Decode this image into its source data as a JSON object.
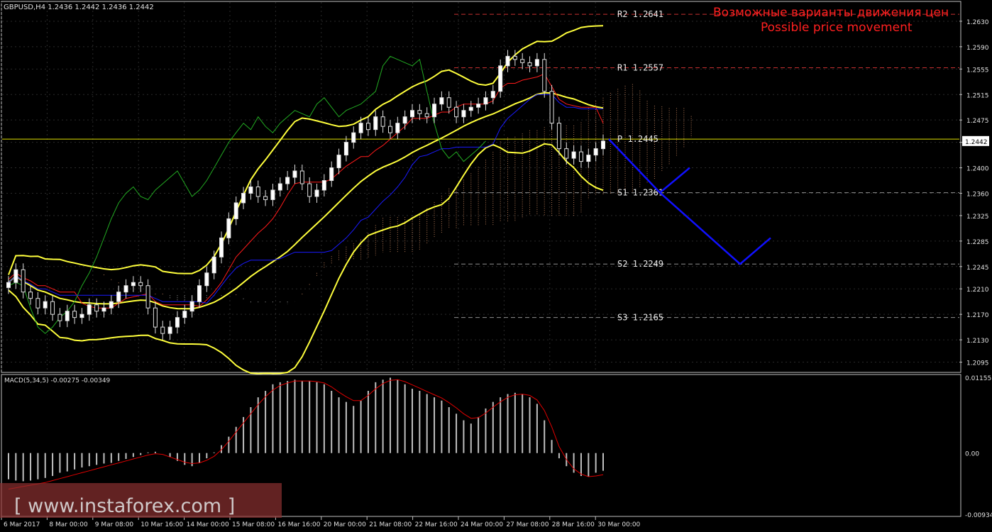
{
  "header": {
    "symbol_line": "GBPUSD,H4  1.2436 1.2442 1.2436 1.2442",
    "macd_line": "MACD(5,34,5) -0.00275 -0.00349"
  },
  "annotations": {
    "title_ru": "Возможные варианты движения цен",
    "title_en": "Possible price movement"
  },
  "watermark": "[ www.instaforex.com ]",
  "colors": {
    "background": "#000000",
    "grid": "#2a2a2a",
    "axis": "#c0c0c0",
    "bollinger": "#ffff3c",
    "tenkan": "#ff1a1a",
    "kijun": "#1a1aff",
    "chikou": "#22aa22",
    "cloud_a": "#f0a070",
    "cloud_b": "#d0d0d0",
    "forecast": "#1010ff",
    "level_red": "#c83030",
    "level_pivot": "#e0e000",
    "annotation_red": "#ff2020",
    "macd_hist": "#c0c0c0",
    "macd_signal": "#e00000"
  },
  "chart_data": {
    "type": "candlestick",
    "instrument": "GBPUSD",
    "timeframe": "H4",
    "ylim": [
      1.208,
      1.266
    ],
    "y_ticks": [
      "1.2630",
      "1.2590",
      "1.2555",
      "1.2515",
      "1.2475",
      "1.2440",
      "1.2400",
      "1.2360",
      "1.2325",
      "1.2285",
      "1.2245",
      "1.2210",
      "1.2170",
      "1.2130",
      "1.2095"
    ],
    "current_price": "1.2442",
    "current_value": 1.2442,
    "x_labels": [
      "6 Mar 2017",
      "8 Mar 00:00",
      "9 Mar 08:00",
      "10 Mar 16:00",
      "14 Mar 00:00",
      "15 Mar 08:00",
      "16 Mar 16:00",
      "20 Mar 00:00",
      "21 Mar 08:00",
      "22 Mar 16:00",
      "24 Mar 00:00",
      "27 Mar 08:00",
      "28 Mar 16:00",
      "30 Mar 00:00"
    ],
    "levels": [
      {
        "label": "R2  1.2641",
        "value": 1.2641,
        "kind": "resistance"
      },
      {
        "label": "R1  1.2557",
        "value": 1.2557,
        "kind": "resistance"
      },
      {
        "label": "P  1.2445",
        "value": 1.2445,
        "kind": "pivot"
      },
      {
        "label": "S1  1.2361",
        "value": 1.2361,
        "kind": "support"
      },
      {
        "label": "S2  1.2249",
        "value": 1.2249,
        "kind": "support"
      },
      {
        "label": "S3  1.2165",
        "value": 1.2165,
        "kind": "support"
      }
    ],
    "forecast_path": [
      1.2445,
      1.2361,
      1.24,
      1.2361,
      1.2249,
      1.229
    ],
    "close": [
      1.222,
      1.224,
      1.2205,
      1.2195,
      1.218,
      1.219,
      1.217,
      1.216,
      1.2175,
      1.2165,
      1.217,
      1.2185,
      1.2175,
      1.218,
      1.219,
      1.2205,
      1.2215,
      1.222,
      1.2215,
      1.218,
      1.215,
      1.214,
      1.215,
      1.2165,
      1.2175,
      1.219,
      1.2215,
      1.2235,
      1.226,
      1.229,
      1.232,
      1.2345,
      1.236,
      1.237,
      1.2355,
      1.235,
      1.2365,
      1.2375,
      1.2385,
      1.2395,
      1.2375,
      1.2355,
      1.2365,
      1.238,
      1.24,
      1.242,
      1.244,
      1.2455,
      1.247,
      1.246,
      1.248,
      1.2465,
      1.2455,
      1.247,
      1.248,
      1.249,
      1.2485,
      1.248,
      1.25,
      1.251,
      1.2495,
      1.248,
      1.249,
      1.2495,
      1.25,
      1.251,
      1.252,
      1.256,
      1.2575,
      1.257,
      1.2565,
      1.256,
      1.257,
      1.252,
      1.247,
      1.243,
      1.2415,
      1.2425,
      1.241,
      1.242,
      1.243,
      1.2442
    ],
    "macd": {
      "ylim": [
        -0.00934,
        0.01155
      ],
      "y_ticks": [
        "0.01155",
        "0.00",
        "-0.00934"
      ],
      "histogram": [
        -0.004,
        -0.0042,
        -0.0043,
        -0.0042,
        -0.004,
        -0.0038,
        -0.0035,
        -0.003,
        -0.0028,
        -0.0025,
        -0.0022,
        -0.002,
        -0.0018,
        -0.0016,
        -0.0015,
        -0.0012,
        -0.0009,
        -0.0006,
        -0.0003,
        0.0001,
        0.0002,
        0.0,
        -0.0006,
        -0.0012,
        -0.0018,
        -0.002,
        -0.0015,
        -0.0008,
        0.0001,
        0.0012,
        0.0025,
        0.004,
        0.0055,
        0.007,
        0.0085,
        0.0095,
        0.0105,
        0.0108,
        0.011,
        0.0112,
        0.011,
        0.011,
        0.0108,
        0.0105,
        0.0095,
        0.0085,
        0.0078,
        0.0072,
        0.008,
        0.0095,
        0.0108,
        0.0112,
        0.0115,
        0.0112,
        0.0105,
        0.0098,
        0.0095,
        0.009,
        0.0085,
        0.008,
        0.007,
        0.006,
        0.005,
        0.0045,
        0.0055,
        0.0068,
        0.0078,
        0.0085,
        0.009,
        0.0092,
        0.009,
        0.0085,
        0.0075,
        0.005,
        0.002,
        -0.0008,
        -0.002,
        -0.003,
        -0.0035,
        -0.0036,
        -0.003,
        -0.0027
      ],
      "signal": [
        -0.0055,
        -0.0053,
        -0.0051,
        -0.0049,
        -0.0047,
        -0.0045,
        -0.0042,
        -0.0039,
        -0.0036,
        -0.0033,
        -0.003,
        -0.0027,
        -0.0024,
        -0.0021,
        -0.0018,
        -0.0015,
        -0.0012,
        -0.0009,
        -0.0006,
        -0.0003,
        -0.0001,
        -0.0002,
        -0.0006,
        -0.001,
        -0.0014,
        -0.0016,
        -0.0015,
        -0.0011,
        -0.0005,
        0.0005,
        0.0018,
        0.0032,
        0.0046,
        0.006,
        0.0074,
        0.0086,
        0.0096,
        0.0103,
        0.0107,
        0.011,
        0.011,
        0.011,
        0.0109,
        0.0107,
        0.0101,
        0.0093,
        0.0086,
        0.008,
        0.008,
        0.0088,
        0.0098,
        0.0106,
        0.0111,
        0.0112,
        0.0109,
        0.0104,
        0.0099,
        0.0094,
        0.0089,
        0.0084,
        0.0077,
        0.0069,
        0.006,
        0.0053,
        0.0054,
        0.0061,
        0.007,
        0.0078,
        0.0085,
        0.0089,
        0.009,
        0.0088,
        0.0081,
        0.0065,
        0.004,
        0.001,
        -0.001,
        -0.0024,
        -0.0032,
        -0.0036,
        -0.0035,
        -0.0033
      ]
    }
  }
}
